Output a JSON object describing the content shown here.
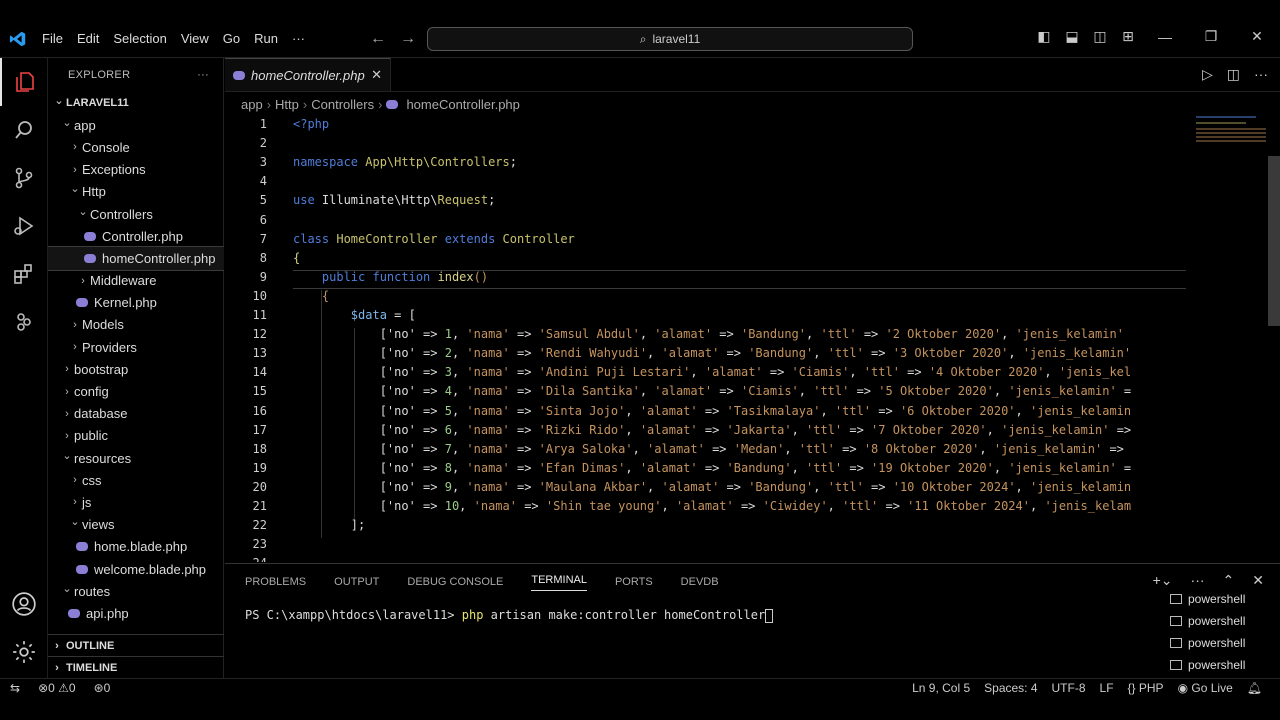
{
  "titlebar": {
    "menu": [
      "File",
      "Edit",
      "Selection",
      "View",
      "Go",
      "Run",
      "···"
    ],
    "search": "laravel11"
  },
  "sidebar": {
    "title": "EXPLORER",
    "more": "···",
    "tree": [
      {
        "label": "LARAVEL11",
        "depth": 0,
        "type": "folder",
        "open": true,
        "bold": true
      },
      {
        "label": "app",
        "depth": 1,
        "type": "folder",
        "open": true
      },
      {
        "label": "Console",
        "depth": 2,
        "type": "folder",
        "open": false
      },
      {
        "label": "Exceptions",
        "depth": 2,
        "type": "folder",
        "open": false
      },
      {
        "label": "Http",
        "depth": 2,
        "type": "folder",
        "open": true
      },
      {
        "label": "Controllers",
        "depth": 3,
        "type": "folder",
        "open": true
      },
      {
        "label": "Controller.php",
        "depth": 4,
        "type": "php"
      },
      {
        "label": "homeController.php",
        "depth": 4,
        "type": "php",
        "selected": true
      },
      {
        "label": "Middleware",
        "depth": 3,
        "type": "folder",
        "open": false
      },
      {
        "label": "Kernel.php",
        "depth": 3,
        "type": "php"
      },
      {
        "label": "Models",
        "depth": 2,
        "type": "folder",
        "open": false
      },
      {
        "label": "Providers",
        "depth": 2,
        "type": "folder",
        "open": false
      },
      {
        "label": "bootstrap",
        "depth": 1,
        "type": "folder",
        "open": false
      },
      {
        "label": "config",
        "depth": 1,
        "type": "folder",
        "open": false
      },
      {
        "label": "database",
        "depth": 1,
        "type": "folder",
        "open": false
      },
      {
        "label": "public",
        "depth": 1,
        "type": "folder",
        "open": false
      },
      {
        "label": "resources",
        "depth": 1,
        "type": "folder",
        "open": true
      },
      {
        "label": "css",
        "depth": 2,
        "type": "folder",
        "open": false
      },
      {
        "label": "js",
        "depth": 2,
        "type": "folder",
        "open": false
      },
      {
        "label": "views",
        "depth": 2,
        "type": "folder",
        "open": true
      },
      {
        "label": "home.blade.php",
        "depth": 3,
        "type": "php"
      },
      {
        "label": "welcome.blade.php",
        "depth": 3,
        "type": "php"
      },
      {
        "label": "routes",
        "depth": 1,
        "type": "folder",
        "open": true
      },
      {
        "label": "api.php",
        "depth": 2,
        "type": "php"
      }
    ],
    "outline": "OUTLINE",
    "timeline": "TIMELINE"
  },
  "editor": {
    "tab": "homeController.php",
    "breadcrumbs": [
      "app",
      "Http",
      "Controllers",
      "homeController.php"
    ],
    "lines": [
      [
        [
          "kw",
          "<?php"
        ]
      ],
      [],
      [
        [
          "kw",
          "namespace "
        ],
        [
          "cls",
          "App\\Http\\Controllers"
        ],
        [
          "",
          "; "
        ]
      ],
      [],
      [
        [
          "kw",
          "use "
        ],
        [
          "",
          "Illuminate\\Http\\"
        ],
        [
          "cls",
          "Request"
        ],
        [
          "",
          ";"
        ]
      ],
      [],
      [
        [
          "kw",
          "class "
        ],
        [
          "cls",
          "HomeController "
        ],
        [
          "kw",
          "extends "
        ],
        [
          "cls",
          "Controller"
        ]
      ],
      [
        [
          "fn",
          "{"
        ]
      ],
      [
        [
          "",
          "    "
        ],
        [
          "kw",
          "public function "
        ],
        [
          "fn",
          "index"
        ],
        [
          "str",
          "()"
        ]
      ],
      [
        [
          "",
          "    "
        ],
        [
          "str",
          "{"
        ]
      ],
      [
        [
          "",
          "        "
        ],
        [
          "var",
          "$data"
        ],
        [
          "",
          " = ["
        ]
      ],
      [
        [
          "",
          "            ['no' => "
        ],
        [
          "num",
          "1"
        ],
        [
          "",
          ", "
        ],
        [
          "str",
          "'nama'"
        ],
        [
          "",
          " => "
        ],
        [
          "str",
          "'Samsul Abdul'"
        ],
        [
          "",
          ", "
        ],
        [
          "str",
          "'alamat'"
        ],
        [
          "",
          " => "
        ],
        [
          "str",
          "'Bandung'"
        ],
        [
          "",
          ", "
        ],
        [
          "str",
          "'ttl'"
        ],
        [
          "",
          " => "
        ],
        [
          "str",
          "'2 Oktober 2020'"
        ],
        [
          "",
          ", "
        ],
        [
          "str",
          "'jenis_kelamin'"
        ]
      ],
      [
        [
          "",
          "            ['no' => "
        ],
        [
          "num",
          "2"
        ],
        [
          "",
          ", "
        ],
        [
          "str",
          "'nama'"
        ],
        [
          "",
          " => "
        ],
        [
          "str",
          "'Rendi Wahyudi'"
        ],
        [
          "",
          ", "
        ],
        [
          "str",
          "'alamat'"
        ],
        [
          "",
          " => "
        ],
        [
          "str",
          "'Bandung'"
        ],
        [
          "",
          ", "
        ],
        [
          "str",
          "'ttl'"
        ],
        [
          "",
          " => "
        ],
        [
          "str",
          "'3 Oktober 2020'"
        ],
        [
          "",
          ", "
        ],
        [
          "str",
          "'jenis_kelamin'"
        ]
      ],
      [
        [
          "",
          "            ['no' => "
        ],
        [
          "num",
          "3"
        ],
        [
          "",
          ", "
        ],
        [
          "str",
          "'nama'"
        ],
        [
          "",
          " => "
        ],
        [
          "str",
          "'Andini Puji Lestari'"
        ],
        [
          "",
          ", "
        ],
        [
          "str",
          "'alamat'"
        ],
        [
          "",
          " => "
        ],
        [
          "str",
          "'Ciamis'"
        ],
        [
          "",
          ", "
        ],
        [
          "str",
          "'ttl'"
        ],
        [
          "",
          " => "
        ],
        [
          "str",
          "'4 Oktober 2020'"
        ],
        [
          "",
          ", "
        ],
        [
          "str",
          "'jenis_kel"
        ]
      ],
      [
        [
          "",
          "            ['no' => "
        ],
        [
          "num",
          "4"
        ],
        [
          "",
          ", "
        ],
        [
          "str",
          "'nama'"
        ],
        [
          "",
          " => "
        ],
        [
          "str",
          "'Dila Santika'"
        ],
        [
          "",
          ", "
        ],
        [
          "str",
          "'alamat'"
        ],
        [
          "",
          " => "
        ],
        [
          "str",
          "'Ciamis'"
        ],
        [
          "",
          ", "
        ],
        [
          "str",
          "'ttl'"
        ],
        [
          "",
          " => "
        ],
        [
          "str",
          "'5 Oktober 2020'"
        ],
        [
          "",
          ", "
        ],
        [
          "str",
          "'jenis_kelamin'"
        ],
        [
          "",
          " ="
        ]
      ],
      [
        [
          "",
          "            ['no' => "
        ],
        [
          "num",
          "5"
        ],
        [
          "",
          ", "
        ],
        [
          "str",
          "'nama'"
        ],
        [
          "",
          " => "
        ],
        [
          "str",
          "'Sinta Jojo'"
        ],
        [
          "",
          ", "
        ],
        [
          "str",
          "'alamat'"
        ],
        [
          "",
          " => "
        ],
        [
          "str",
          "'Tasikmalaya'"
        ],
        [
          "",
          ", "
        ],
        [
          "str",
          "'ttl'"
        ],
        [
          "",
          " => "
        ],
        [
          "str",
          "'6 Oktober 2020'"
        ],
        [
          "",
          ", "
        ],
        [
          "str",
          "'jenis_kelamin"
        ]
      ],
      [
        [
          "",
          "            ['no' => "
        ],
        [
          "num",
          "6"
        ],
        [
          "",
          ", "
        ],
        [
          "str",
          "'nama'"
        ],
        [
          "",
          " => "
        ],
        [
          "str",
          "'Rizki Rido'"
        ],
        [
          "",
          ", "
        ],
        [
          "str",
          "'alamat'"
        ],
        [
          "",
          " => "
        ],
        [
          "str",
          "'Jakarta'"
        ],
        [
          "",
          ", "
        ],
        [
          "str",
          "'ttl'"
        ],
        [
          "",
          " => "
        ],
        [
          "str",
          "'7 Oktober 2020'"
        ],
        [
          "",
          ", "
        ],
        [
          "str",
          "'jenis_kelamin'"
        ],
        [
          "",
          " =>"
        ]
      ],
      [
        [
          "",
          "            ['no' => "
        ],
        [
          "num",
          "7"
        ],
        [
          "",
          ", "
        ],
        [
          "str",
          "'nama'"
        ],
        [
          "",
          " => "
        ],
        [
          "str",
          "'Arya Saloka'"
        ],
        [
          "",
          ", "
        ],
        [
          "str",
          "'alamat'"
        ],
        [
          "",
          " => "
        ],
        [
          "str",
          "'Medan'"
        ],
        [
          "",
          ", "
        ],
        [
          "str",
          "'ttl'"
        ],
        [
          "",
          " => "
        ],
        [
          "str",
          "'8 Oktober 2020'"
        ],
        [
          "",
          ", "
        ],
        [
          "str",
          "'jenis_kelamin'"
        ],
        [
          "",
          " =>"
        ]
      ],
      [
        [
          "",
          "            ['no' => "
        ],
        [
          "num",
          "8"
        ],
        [
          "",
          ", "
        ],
        [
          "str",
          "'nama'"
        ],
        [
          "",
          " => "
        ],
        [
          "str",
          "'Efan Dimas'"
        ],
        [
          "",
          ", "
        ],
        [
          "str",
          "'alamat'"
        ],
        [
          "",
          " => "
        ],
        [
          "str",
          "'Bandung'"
        ],
        [
          "",
          ", "
        ],
        [
          "str",
          "'ttl'"
        ],
        [
          "",
          " => "
        ],
        [
          "str",
          "'19 Oktober 2020'"
        ],
        [
          "",
          ", "
        ],
        [
          "str",
          "'jenis_kelamin'"
        ],
        [
          "",
          " ="
        ]
      ],
      [
        [
          "",
          "            ['no' => "
        ],
        [
          "num",
          "9"
        ],
        [
          "",
          ", "
        ],
        [
          "str",
          "'nama'"
        ],
        [
          "",
          " => "
        ],
        [
          "str",
          "'Maulana Akbar'"
        ],
        [
          "",
          ", "
        ],
        [
          "str",
          "'alamat'"
        ],
        [
          "",
          " => "
        ],
        [
          "str",
          "'Bandung'"
        ],
        [
          "",
          ", "
        ],
        [
          "str",
          "'ttl'"
        ],
        [
          "",
          " => "
        ],
        [
          "str",
          "'10 Oktober 2024'"
        ],
        [
          "",
          ", "
        ],
        [
          "str",
          "'jenis_kelamin"
        ]
      ],
      [
        [
          "",
          "            ['no' => "
        ],
        [
          "num",
          "10"
        ],
        [
          "",
          ", "
        ],
        [
          "str",
          "'nama'"
        ],
        [
          "",
          " => "
        ],
        [
          "str",
          "'Shin tae young'"
        ],
        [
          "",
          ", "
        ],
        [
          "str",
          "'alamat'"
        ],
        [
          "",
          " => "
        ],
        [
          "str",
          "'Ciwidey'"
        ],
        [
          "",
          ", "
        ],
        [
          "str",
          "'ttl'"
        ],
        [
          "",
          " => "
        ],
        [
          "str",
          "'11 Oktober 2024'"
        ],
        [
          "",
          ", "
        ],
        [
          "str",
          "'jenis_kelam"
        ]
      ],
      [
        [
          "",
          "        ];"
        ]
      ],
      [],
      []
    ]
  },
  "panel": {
    "tabs": [
      "PROBLEMS",
      "OUTPUT",
      "DEBUG CONSOLE",
      "TERMINAL",
      "PORTS",
      "DEVDB"
    ],
    "active_tab": "TERMINAL",
    "prompt": "PS C:\\xampp\\htdocs\\laravel11> ",
    "command_word": "php",
    "command_rest": " artisan make:controller homeController",
    "shells": [
      "powershell",
      "powershell",
      "powershell",
      "powershell"
    ]
  },
  "status": {
    "errors": "0",
    "warnings": "0",
    "ports": "0",
    "position": "Ln 9, Col 5",
    "spaces": "Spaces: 4",
    "encoding": "UTF-8",
    "eol": "LF",
    "language": "PHP",
    "golive": "Go Live"
  },
  "colors": {
    "accent": "#8a7fd4",
    "keyword": "#4f7dd8",
    "string": "#c5935e",
    "class": "#c9c26b"
  }
}
